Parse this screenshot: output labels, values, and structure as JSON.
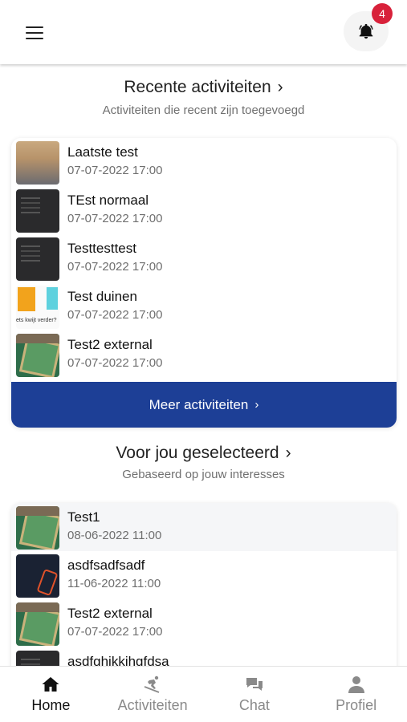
{
  "header": {
    "notification_count": "4",
    "menu_icon": "hamburger-menu-icon",
    "bell_icon": "bell-icon"
  },
  "recent": {
    "title": "Recente activiteiten",
    "subtitle": "Activiteiten die recent zijn toegevoegd",
    "items": [
      {
        "title": "Laatste test",
        "date": "07-07-2022 17:00",
        "thumb": "person-photo"
      },
      {
        "title": "TEst normaal",
        "date": "07-07-2022 17:00",
        "thumb": "dark-screenshot"
      },
      {
        "title": "Testtesttest",
        "date": "07-07-2022 17:00",
        "thumb": "dark-screenshot"
      },
      {
        "title": "Test duinen",
        "date": "07-07-2022 17:00",
        "thumb": "sticky-notes",
        "thumb_caption": "ets kwijt verder?"
      },
      {
        "title": "Test2 external",
        "date": "07-07-2022 17:00",
        "thumb": "board-game"
      }
    ],
    "more_label": "Meer activiteiten"
  },
  "selected": {
    "title": "Voor jou geselecteerd",
    "subtitle": "Gebaseerd op jouw interesses",
    "items": [
      {
        "title": "Test1",
        "date": "08-06-2022 11:00",
        "thumb": "board-game"
      },
      {
        "title": "asdfsadfsadf",
        "date": "11-06-2022 11:00",
        "thumb": "night-neon"
      },
      {
        "title": "Test2 external",
        "date": "07-07-2022 17:00",
        "thumb": "board-game"
      },
      {
        "title": "asdfghjkkjhgfdsa",
        "date": "",
        "thumb": "dark-screenshot"
      }
    ]
  },
  "nav": {
    "items": [
      {
        "label": "Home",
        "icon": "home-icon",
        "active": true
      },
      {
        "label": "Activiteiten",
        "icon": "skiing-person-icon",
        "active": false
      },
      {
        "label": "Chat",
        "icon": "chat-bubbles-icon",
        "active": false
      },
      {
        "label": "Profiel",
        "icon": "user-icon",
        "active": false
      }
    ]
  },
  "colors": {
    "primary": "#1d3f96",
    "badge": "#d8213a",
    "muted_text": "#6f6f6f"
  }
}
